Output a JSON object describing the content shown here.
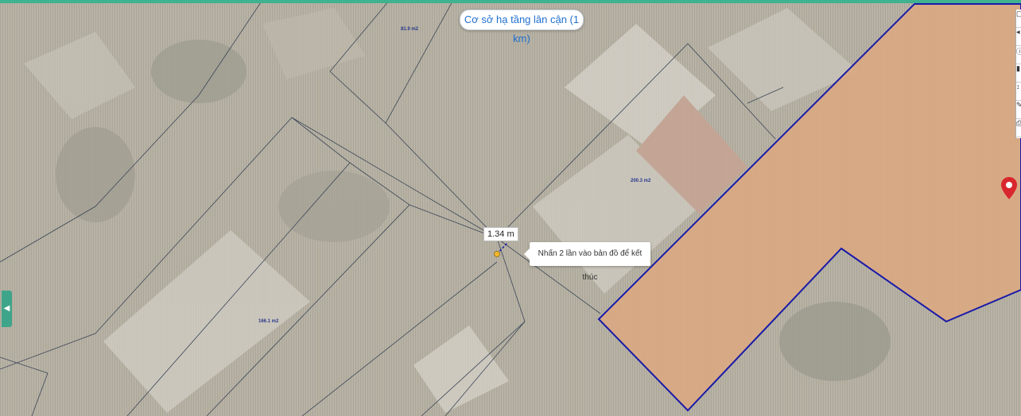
{
  "nearby_button": {
    "label": "Cơ sở hạ tầng lân cận (1 km)"
  },
  "measurement": {
    "distance_label": "1.34 m"
  },
  "tooltip": {
    "text": "Nhấn 2 lần vào bản đồ để kết thúc"
  },
  "parcels": [
    {
      "id": "parcel-1",
      "area_label": "81.9 m2"
    },
    {
      "id": "parcel-2",
      "area_label": "200.3 m2"
    },
    {
      "id": "parcel-3",
      "area_label": "166.1 m2"
    }
  ],
  "colors": {
    "accent": "#3fb28f",
    "selection_fill": "#d9a982",
    "selection_border": "#1a1aa8",
    "marker": "#d9272e"
  },
  "toolbar": {
    "icons": [
      "layers-icon",
      "back-icon",
      "info-icon",
      "ruler-icon",
      "zoom-icon",
      "draw-icon",
      "print-icon"
    ]
  }
}
